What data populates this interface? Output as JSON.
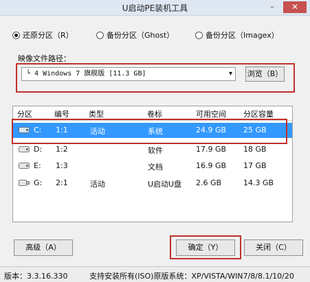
{
  "window": {
    "title": "U启动PE装机工具",
    "min_glyph": "–",
    "close_glyph": "✕"
  },
  "modes": [
    {
      "label": "还原分区（R）",
      "selected": true
    },
    {
      "label": "备份分区（Ghost）",
      "selected": false
    },
    {
      "label": "备份分区（Imagex）",
      "selected": false
    }
  ],
  "image_path": {
    "label": "映像文件路径：",
    "value": "└ 4 Windows 7 旗舰版 [11.3 GB]",
    "dropdown_glyph": "▾",
    "browse_label": "浏览（B）"
  },
  "table": {
    "headers": [
      "分区",
      "编号",
      "类型",
      "卷标",
      "可用空间",
      "分区容量"
    ],
    "rows": [
      {
        "drive": "C:",
        "num": "1:1",
        "type": "活动",
        "label": "系统",
        "free": "24.9 GB",
        "size": "25 GB",
        "selected": true
      },
      {
        "drive": "D:",
        "num": "1:2",
        "type": "",
        "label": "软件",
        "free": "17.9 GB",
        "size": "18 GB",
        "selected": false
      },
      {
        "drive": "E:",
        "num": "1:3",
        "type": "",
        "label": "文档",
        "free": "16.9 GB",
        "size": "17 GB",
        "selected": false
      },
      {
        "drive": "G:",
        "num": "2:1",
        "type": "活动",
        "label": "U启动U盘",
        "free": "2.6 GB",
        "size": "14.3 GB",
        "selected": false
      }
    ]
  },
  "buttons": {
    "advanced": "高级（A）",
    "ok": "确定（Y）",
    "close": "关闭（C）"
  },
  "status": {
    "version": "版本：3.3.16.330",
    "support": "支持安装所有(ISO)原版系统：XP/VISTA/WIN7/8/8.1/10/20"
  },
  "colors": {
    "selection": "#3399ff",
    "highlight": "#c0302a"
  }
}
